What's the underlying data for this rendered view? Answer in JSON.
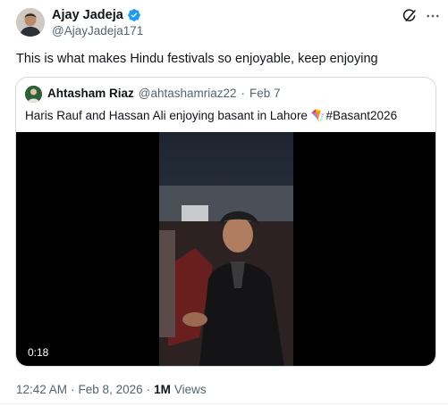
{
  "author": {
    "name": "Ajay Jadeja",
    "handle": "@AjayJadeja171"
  },
  "tweet": {
    "text": "This is what makes Hindu festivals so enjoyable, keep enjoying"
  },
  "quote": {
    "name": "Ahtasham Riaz",
    "handle": "@ahtashamriaz22",
    "separator": "·",
    "date": "Feb 7",
    "text": "Haris Rauf and Hassan Ali enjoying basant in Lahore 🪁#Basant2026",
    "video_duration": "0:18"
  },
  "footer": {
    "time": "12:42 AM",
    "separator": "·",
    "date": "Feb 8, 2026",
    "views_count": "1M",
    "views_label": "Views"
  },
  "colors": {
    "verified": "#1d9bf0",
    "secondary_text": "#536471",
    "border": "#cfd9de"
  }
}
